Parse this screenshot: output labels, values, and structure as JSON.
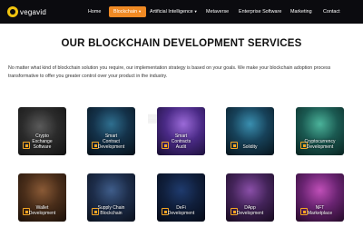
{
  "brand": {
    "name": "vegavid"
  },
  "nav": {
    "items": [
      {
        "label": "Home",
        "active": false
      },
      {
        "label": "Blockchain",
        "active": true,
        "dropdown": true
      },
      {
        "label": "Artificial Intelligence",
        "active": false,
        "dropdown": true
      },
      {
        "label": "Metaverse",
        "active": false
      },
      {
        "label": "Enterprise Software",
        "active": false
      },
      {
        "label": "Marketing",
        "active": false
      },
      {
        "label": "Contact",
        "active": false
      }
    ]
  },
  "section": {
    "title": "OUR BLOCKCHAIN DEVELOPMENT SERVICES",
    "intro": "No matter what kind of blockchain solution you require, our implementation strategy is based on your goals. We make your blockchain adoption process transformative to offer you greater control over your product in the industry."
  },
  "services": [
    {
      "label": "Crypto\nExchange\nSoftware",
      "icon": "exchange-icon"
    },
    {
      "label": "Smart\nContract\nDevelopment",
      "icon": "contract-icon"
    },
    {
      "label": "Smart\nContracts\nAudit",
      "icon": "audit-icon"
    },
    {
      "label": "Solidity",
      "icon": "code-icon"
    },
    {
      "label": "Cryptocurrency\nDevelopment",
      "icon": "coin-icon"
    },
    {
      "label": "Wallet\nDevelopment",
      "icon": "wallet-icon"
    },
    {
      "label": "Supply Chain\nBlockchain",
      "icon": "supply-chain-icon"
    },
    {
      "label": "DeFi\nDevelopment",
      "icon": "defi-icon"
    },
    {
      "label": "DApp\nDevelopment",
      "icon": "dapp-icon"
    },
    {
      "label": "NFT\nMarketplace",
      "icon": "nft-icon"
    }
  ],
  "colors": {
    "navbar": "#0b0b0f",
    "accent": "#f08a24",
    "logo": "#f1c40f"
  }
}
